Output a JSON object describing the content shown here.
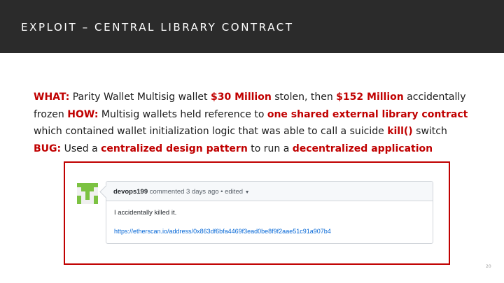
{
  "slide": {
    "title": "EXPLOIT – CENTRAL LIBRARY CONTRACT",
    "page_number": "20"
  },
  "body": {
    "line1": {
      "what_label": "WHAT:",
      "t1": " Parity Wallet Multisig wallet ",
      "amount1": "$30 Million",
      "t2": " stolen, then ",
      "amount2": "$152 Million",
      "t3": " accidentally"
    },
    "line2": {
      "t1": "frozen ",
      "how_label": "HOW:",
      "t2": " Multisig wallets held reference to ",
      "highlight": "one shared external library contract"
    },
    "line3": {
      "t1": "which contained wallet initialization logic that was able to call a suicide ",
      "highlight": "kill()",
      "t2": " switch"
    },
    "line4": {
      "bug_label": "BUG:",
      "t1": " Used a ",
      "highlight1": "centralized design pattern",
      "t2": " to run a ",
      "highlight2": "decentralized application"
    }
  },
  "comment": {
    "author": "devops199",
    "meta": " commented 3 days ago • edited ",
    "text": "I accidentally killed it.",
    "link": "https://etherscan.io/address/0x863df6bfa4469f3ead0be8f9f2aae51c91a907b4"
  },
  "colors": {
    "title_bar": "#2b2b2b",
    "accent_red": "#c00000",
    "link_blue": "#0366d6",
    "avatar_green": "#7cc242"
  },
  "icons": {
    "avatar": "identicon-avatar",
    "caret": "caret-down-icon"
  }
}
